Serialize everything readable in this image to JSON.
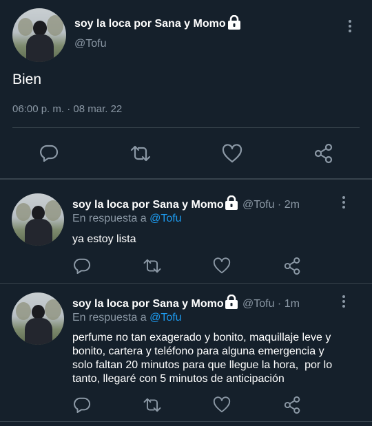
{
  "main_tweet": {
    "author_name": "soy la loca por Sana y Momo",
    "handle": "@Tofu",
    "text": "Bien",
    "timestamp": "06:00 p. m. · 08 mar. 22",
    "avatar": "profile-photo",
    "locked": true
  },
  "replies": [
    {
      "author_name": "soy la loca por Sana y Momo",
      "handle_time": "@Tofu · 2m",
      "reply_prefix": "En respuesta a",
      "reply_to": "@Tofu",
      "text": "ya estoy lista",
      "avatar": "profile-photo",
      "locked": true
    },
    {
      "author_name": "soy la loca por Sana y Momo",
      "handle_time": "@Tofu · 1m",
      "reply_prefix": "En respuesta a",
      "reply_to": "@Tofu",
      "text_lines": [
        "perfume no tan exagerado y bonito, maquillaje leve y",
        "bonito, cartera y teléfono para alguna emergencia y",
        "solo faltan 20 minutos para que llegue la hora,  por lo",
        "tanto, llegaré con 5 minutos de anticipación"
      ],
      "avatar": "profile-photo",
      "locked": true
    }
  ],
  "actions": [
    "reply-icon",
    "retweet-icon",
    "like-icon",
    "share-icon"
  ],
  "colors": {
    "background": "#15202b",
    "secondary_text": "#8b98a5",
    "mention": "#1d9bf0",
    "divider": "#38444d"
  }
}
